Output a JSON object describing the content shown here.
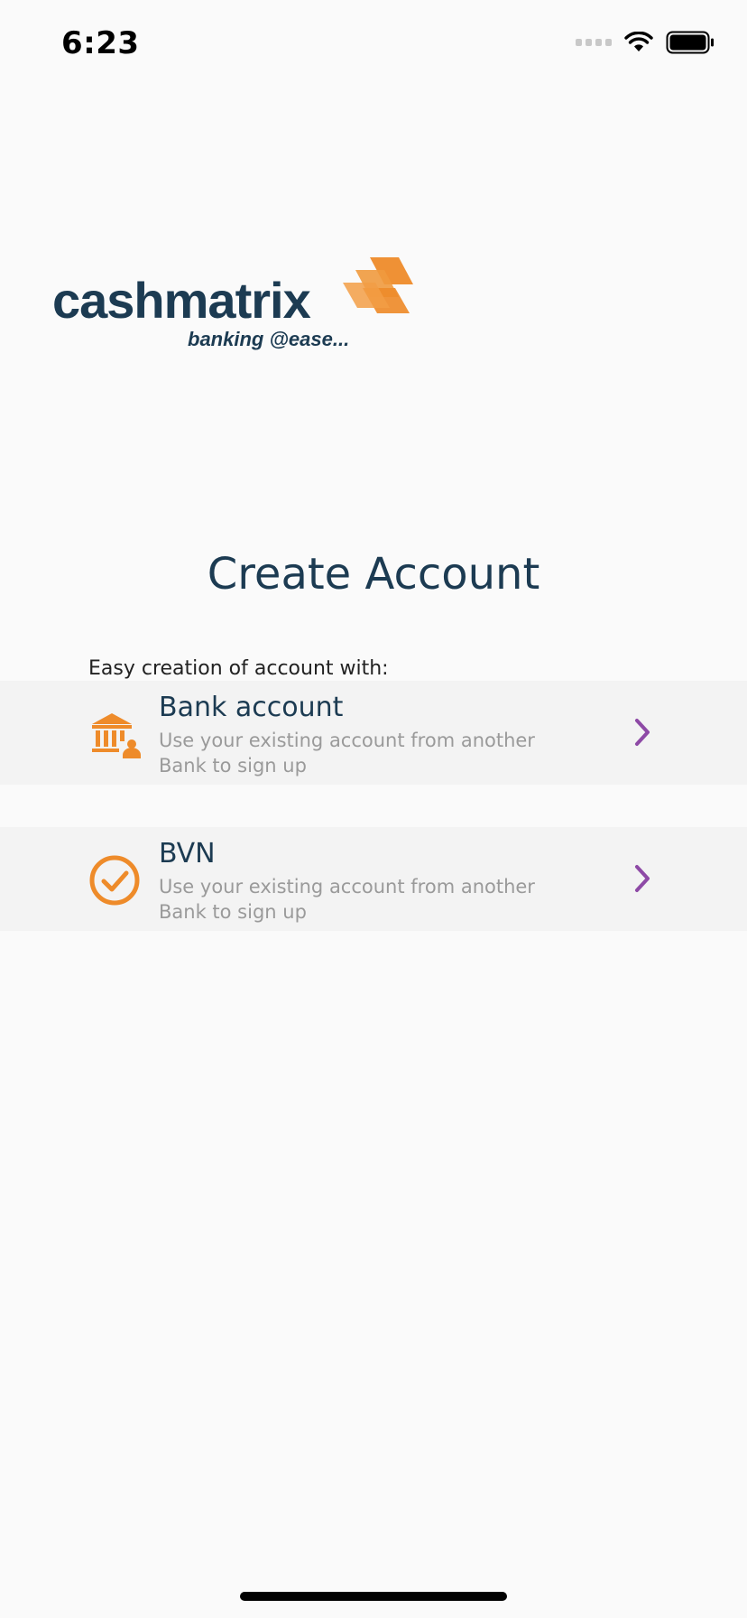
{
  "status_bar": {
    "time": "6:23"
  },
  "logo": {
    "wordmark": "cashmatrix",
    "tagline": "banking @ease..."
  },
  "page": {
    "title": "Create Account",
    "subtitle": "Easy creation of account with:"
  },
  "options": [
    {
      "title": "Bank account",
      "description": "Use your existing account from another\n Bank to sign up",
      "icon": "bank-icon"
    },
    {
      "title": "BVN",
      "description": "Use your existing account from another\n Bank to sign up",
      "icon": "check-circle-icon"
    }
  ],
  "colors": {
    "brand_navy": "#1c3b52",
    "brand_orange": "#ee8b2a",
    "chevron_purple": "#8e4aa6",
    "row_background": "#f3f3f3",
    "description_gray": "#9a9a9a"
  }
}
